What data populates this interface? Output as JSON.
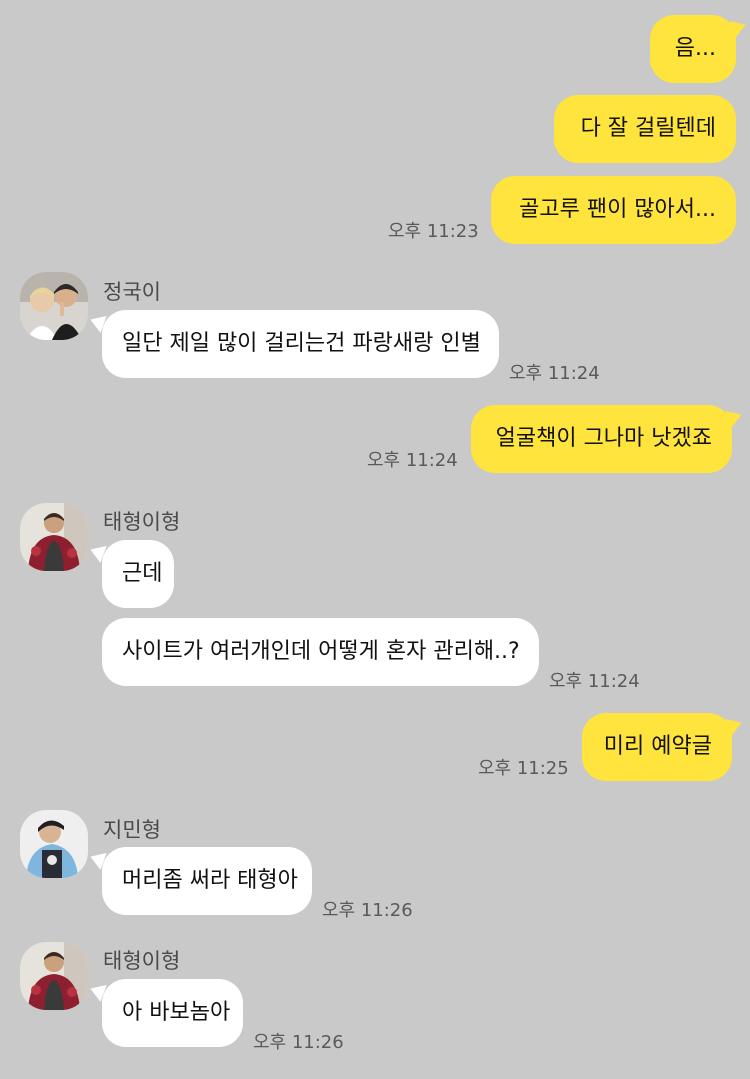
{
  "chat": {
    "m1": {
      "text": "음..."
    },
    "m2": {
      "text": "다 잘 걸릴텐데"
    },
    "m3": {
      "text": "골고루 팬이 많아서...",
      "time": "오후 11:23"
    },
    "g1": {
      "sender": "정국이",
      "text": "일단 제일 많이 걸리는건 파랑새랑 인별",
      "time": "오후 11:24"
    },
    "m4": {
      "text": "얼굴책이 그나마 낫겠죠",
      "time": "오후 11:24"
    },
    "g2": {
      "sender": "태형이형",
      "text1": "근데",
      "text2": "사이트가 여러개인데 어떻게 혼자 관리해..?",
      "time": "오후 11:24"
    },
    "m5": {
      "text": "미리 예약글",
      "time": "오후 11:25"
    },
    "g3": {
      "sender": "지민형",
      "text": "머리좀 써라 태형아",
      "time": "오후 11:26"
    },
    "g4": {
      "sender": "태형이형",
      "text": "아 바보놈아",
      "time": "오후 11:26"
    }
  },
  "colors": {
    "background": "#c9c9c9",
    "my_bubble": "#fee43c",
    "their_bubble": "#ffffff"
  },
  "icons": {
    "avatar_jungkook": "profile-photo",
    "avatar_taehyung": "profile-photo",
    "avatar_jimin": "profile-photo"
  }
}
